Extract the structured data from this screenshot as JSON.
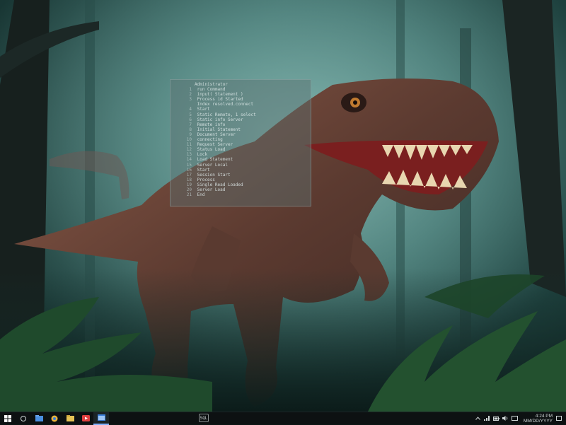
{
  "desktop": {
    "wallpaper": "dinosaur-in-misty-forest"
  },
  "terminal": {
    "lines": [
      {
        "num": "",
        "text": "Administrator"
      },
      {
        "num": "1",
        "text": "  run Command"
      },
      {
        "num": "2",
        "text": "    input( Statement )"
      },
      {
        "num": "3",
        "text": "    Process  id   Started"
      },
      {
        "num": "",
        "text": "    Index  resolved.connect"
      },
      {
        "num": "4",
        "text": "    Start"
      },
      {
        "num": "5",
        "text": "    Static  Remote, 1  select"
      },
      {
        "num": "6",
        "text": "    Static  info  Server"
      },
      {
        "num": "7",
        "text": "    Remote  info"
      },
      {
        "num": "8",
        "text": "    Initial  Statement"
      },
      {
        "num": "9",
        "text": "    Document  Server"
      },
      {
        "num": "10",
        "text": "    connecting"
      },
      {
        "num": "11",
        "text": "    Request  Server"
      },
      {
        "num": "12",
        "text": "    Status  Load"
      },
      {
        "num": "13",
        "text": "    Lock"
      },
      {
        "num": "14",
        "text": "    Load  Statement"
      },
      {
        "num": "15",
        "text": "    Server  Local"
      },
      {
        "num": "16",
        "text": "    Start"
      },
      {
        "num": "17",
        "text": "    Session  Start"
      },
      {
        "num": "18",
        "text": "    Process"
      },
      {
        "num": "19",
        "text": "    Single  Read  Loaded"
      },
      {
        "num": "20",
        "text": "    Server  Load"
      },
      {
        "num": "21",
        "text": "    End"
      }
    ]
  },
  "taskbar": {
    "apps": [
      {
        "icon": "windows-start-icon",
        "color": "#ffffff"
      },
      {
        "icon": "search-icon",
        "color": "#cfd6d6"
      },
      {
        "icon": "folder-icon",
        "color": "#4a8fe0"
      },
      {
        "icon": "browser-icon",
        "color": "#e8b33c"
      },
      {
        "icon": "file-explorer-icon",
        "color": "#e5c255"
      },
      {
        "icon": "media-icon",
        "color": "#e04040"
      },
      {
        "icon": "app-window-icon",
        "color": "#3b7ed8"
      }
    ],
    "center_icon_label": "SQL",
    "clock_time": "4:24 PM",
    "clock_date": "MM/DD/YYYY"
  }
}
